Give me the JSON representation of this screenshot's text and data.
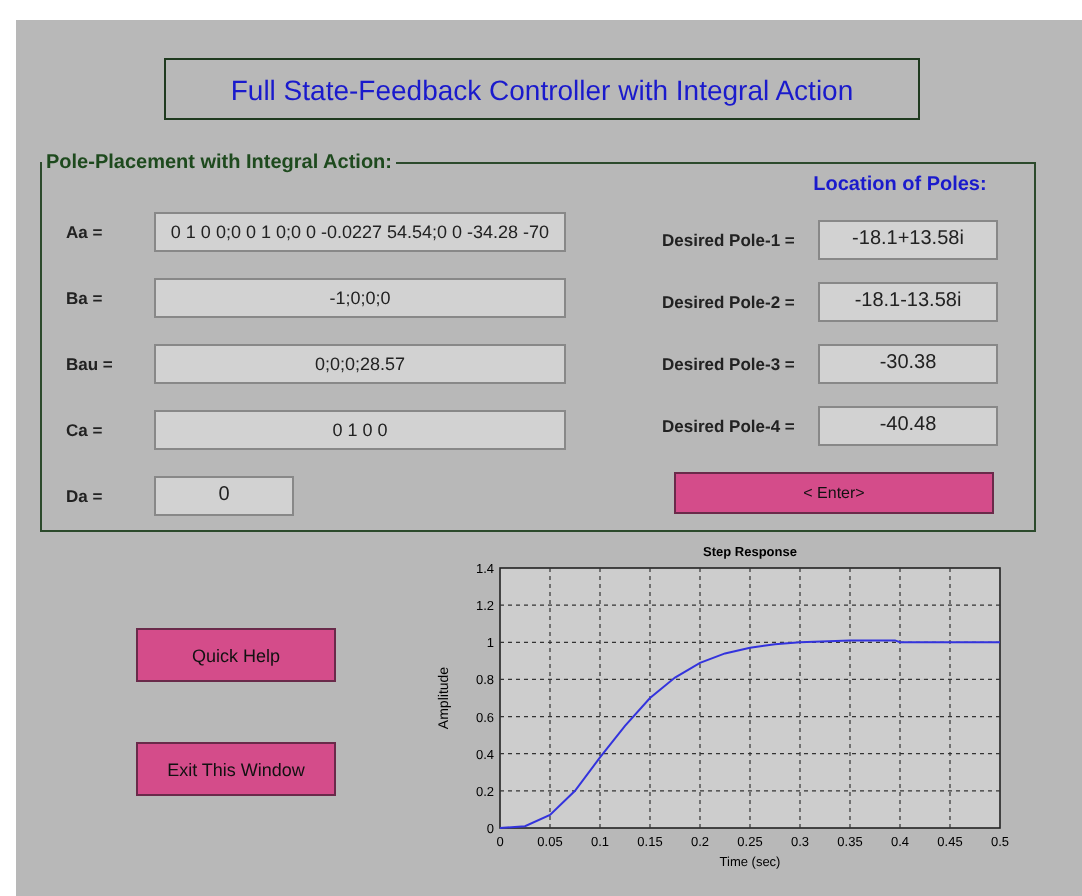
{
  "window": {
    "title": "Full State-Feedback Controller with Integral Action"
  },
  "group": {
    "title": "Pole-Placement with Integral Action:",
    "matrices": [
      {
        "label": "Aa =",
        "value": "0 1 0 0;0 0 1 0;0 0 -0.0227 54.54;0 0 -34.28 -70",
        "kind": "wide"
      },
      {
        "label": "Ba =",
        "value": "-1;0;0;0",
        "kind": "wide"
      },
      {
        "label": "Bau =",
        "value": "0;0;0;28.57",
        "kind": "wide"
      },
      {
        "label": "Ca =",
        "value": "0 1 0 0",
        "kind": "wide"
      },
      {
        "label": "Da =",
        "value": "0",
        "kind": "short"
      }
    ],
    "poles_title": "Location of Poles:",
    "poles": [
      {
        "label": "Desired Pole-1 =",
        "value": "-18.1+13.58i"
      },
      {
        "label": "Desired Pole-2 =",
        "value": "-18.1-13.58i"
      },
      {
        "label": "Desired Pole-3 =",
        "value": "-30.38"
      },
      {
        "label": "Desired Pole-4 =",
        "value": "-40.48"
      }
    ],
    "enter_button": "< Enter>"
  },
  "buttons": [
    "Quick Help",
    "Exit This Window"
  ],
  "plot": {
    "chart_data": {
      "type": "line",
      "title": "Step Response",
      "xlabel": "Time (sec)",
      "ylabel": "Amplitude",
      "x": [
        0,
        0.025,
        0.05,
        0.075,
        0.1,
        0.125,
        0.15,
        0.175,
        0.2,
        0.225,
        0.25,
        0.275,
        0.3,
        0.35,
        0.395,
        0.4,
        0.45,
        0.5
      ],
      "series": [
        {
          "color": "#3333dd",
          "values": [
            0,
            0.01,
            0.07,
            0.2,
            0.38,
            0.55,
            0.7,
            0.81,
            0.89,
            0.94,
            0.97,
            0.99,
            1.0,
            1.01,
            1.01,
            1.0,
            1.0,
            1.0
          ]
        }
      ],
      "grid": true,
      "xlim": [
        0,
        0.5
      ],
      "ylim": [
        0,
        1.4
      ],
      "xticks": [
        {
          "value": 0,
          "label": "0"
        },
        {
          "value": 0.05,
          "label": "0.05"
        },
        {
          "value": 0.1,
          "label": "0.1"
        },
        {
          "value": 0.15,
          "label": "0.15"
        },
        {
          "value": 0.2,
          "label": "0.2"
        },
        {
          "value": 0.25,
          "label": "0.25"
        },
        {
          "value": 0.3,
          "label": "0.3"
        },
        {
          "value": 0.35,
          "label": "0.35"
        },
        {
          "value": 0.4,
          "label": "0.4"
        },
        {
          "value": 0.45,
          "label": "0.45"
        },
        {
          "value": 0.5,
          "label": "0.5"
        }
      ],
      "yticks": [
        {
          "value": 0,
          "label": "0"
        },
        {
          "value": 0.2,
          "label": "0.2"
        },
        {
          "value": 0.4,
          "label": "0.4"
        },
        {
          "value": 0.6,
          "label": "0.6"
        },
        {
          "value": 0.8,
          "label": "0.8"
        },
        {
          "value": 1,
          "label": "1"
        },
        {
          "value": 1.2,
          "label": "1.2"
        },
        {
          "value": 1.4,
          "label": "1.4"
        }
      ]
    }
  }
}
